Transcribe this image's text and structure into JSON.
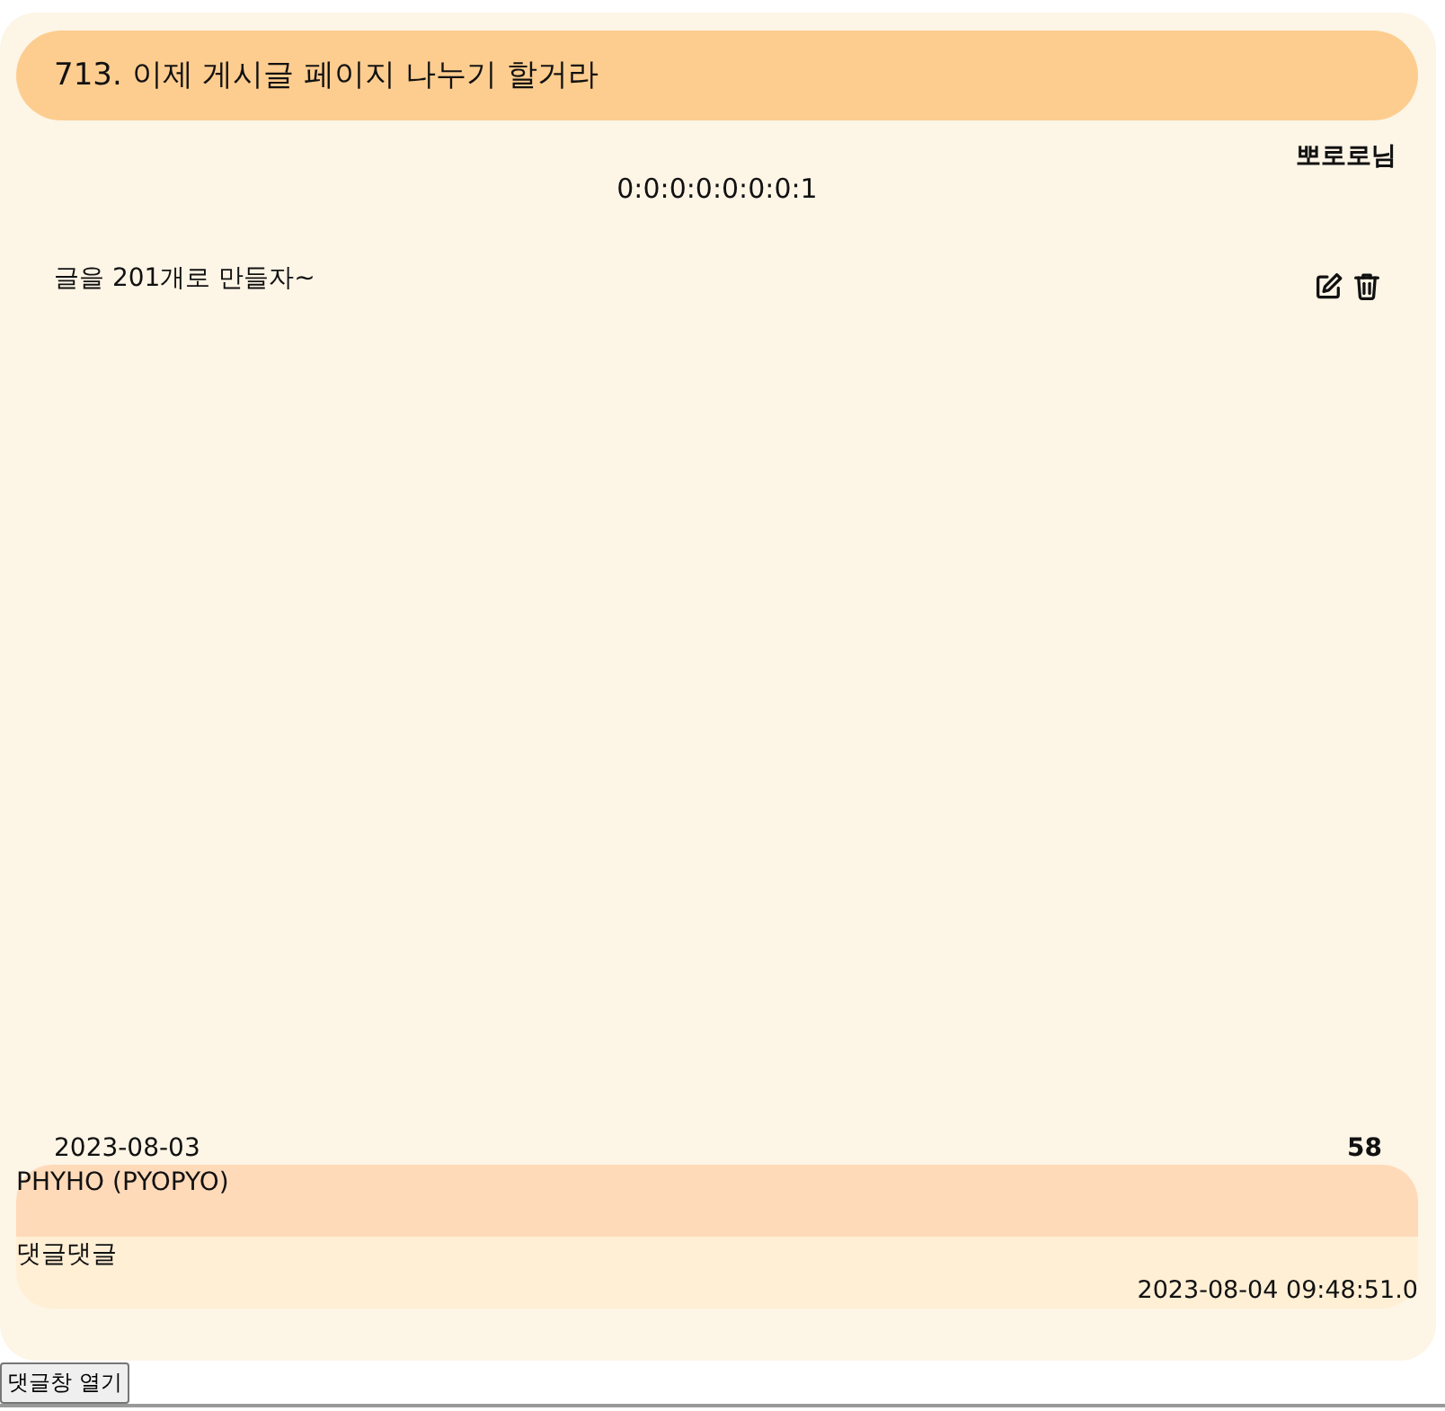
{
  "post": {
    "title": "713. 이제 게시글 페이지 나누기 할거라",
    "author": "뽀로로님",
    "ip": "0:0:0:0:0:0:0:1",
    "content": "글을 201개로 만들자~",
    "date": "2023-08-03",
    "count": "58"
  },
  "comments": [
    {
      "author": "PHYHO (PYOPYO)",
      "content": "댓글댓글",
      "date": "2023-08-04 09:48:51.0"
    }
  ],
  "comment_toggle": {
    "label": "댓글창 열기"
  }
}
